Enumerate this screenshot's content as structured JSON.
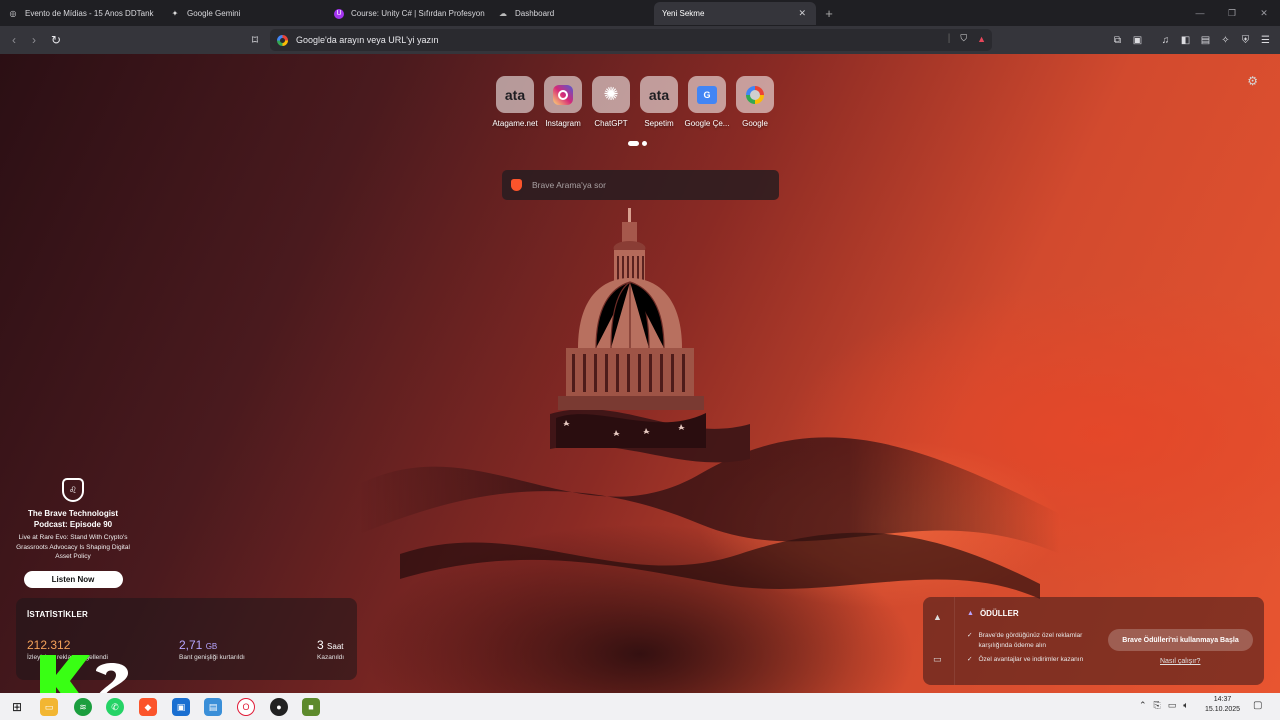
{
  "tabs": [
    {
      "title": "Evento de Mídias - 15 Anos DDTank",
      "icon": "globe-icon"
    },
    {
      "title": "Google Gemini",
      "icon": "gemini-icon"
    },
    {
      "title": "Course: Unity C# | Sıfırdan Profesyon",
      "icon": "udemy-icon"
    },
    {
      "title": "Dashboard",
      "icon": "cloud-icon"
    },
    {
      "title": "Yeni Sekme",
      "icon": "",
      "active": true
    }
  ],
  "address_bar": {
    "placeholder": "Google'da arayın veya URL'yi yazın"
  },
  "top_sites": [
    {
      "label": "Atagame.net",
      "tile": "ata"
    },
    {
      "label": "Instagram",
      "tile": ""
    },
    {
      "label": "ChatGPT",
      "tile": ""
    },
    {
      "label": "Sepetim",
      "tile": "ata"
    },
    {
      "label": "Google Çe...",
      "tile": ""
    },
    {
      "label": "Google",
      "tile": ""
    }
  ],
  "search": {
    "placeholder": "Brave Arama'ya sor"
  },
  "podcast": {
    "title": "The Brave Technologist Podcast: Episode 90",
    "subtitle": "Live at Rare Evo: Stand With Crypto's Grassroots Advocacy Is Shaping Digital Asset Policy",
    "button": "Listen Now"
  },
  "stats": {
    "heading": "İSTATİSTİKLER",
    "items": [
      {
        "value": "212.312",
        "unit": "",
        "desc": "İzleyici ve reklam engellendi",
        "color": "#f5a25a"
      },
      {
        "value": "2,71",
        "unit": "GB",
        "desc": "Bant genişliği kurtarıldı",
        "color": "#b7a6ff"
      },
      {
        "value": "3",
        "unit": "Saat",
        "desc": "Kazanıldı",
        "color": "#ffffff"
      }
    ]
  },
  "rewards": {
    "heading": "ÖDÜLLER",
    "benefits": [
      "Brave'de gördüğünüz özel reklamlar karşılığında ödeme alın",
      "Özel avantajlar ve indirimler kazanın"
    ],
    "cta": "Brave Ödülleri'ni kullanmaya Başla",
    "link": "Nasıl çalışır?"
  },
  "clock": {
    "time": "14:37",
    "date": "15.10.2025"
  },
  "colors": {
    "brave_orange": "#fb542b",
    "tab_bg": "#1f1f23",
    "toolbar_bg": "#35353b"
  }
}
